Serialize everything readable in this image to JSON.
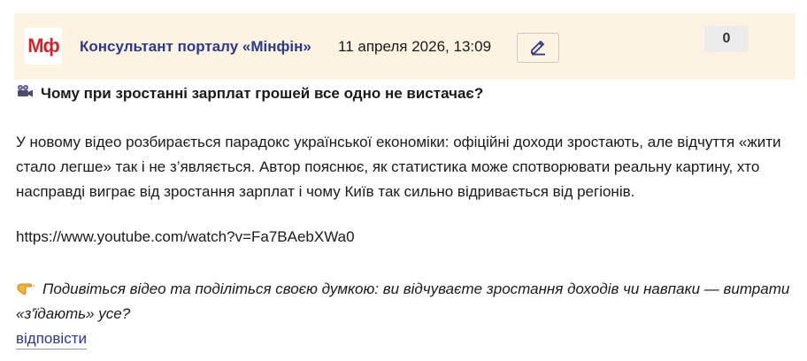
{
  "header": {
    "logo_text": "Мф",
    "author": "Консультант порталу «Мінфін»",
    "date": "11 апреля 2026, 13:09",
    "counter": "0",
    "edit_icon": "pencil-icon",
    "background": "#fcf3e2"
  },
  "post": {
    "title_icon": "camera-icon",
    "title": "Чому при зростанні зарплат грошей все одно не вистачає?",
    "body": "У новому відео розбирається парадокс української економіки: офіційні доходи зростають, але відчуття «жити стало легше» так і не з’являється. Автор пояснює, як статистика може спотворювати реальну картину, хто насправді виграє від зростання зарплат і чому Київ так сильно відривається від регіонів.",
    "link": "https://www.youtube.com/watch?v=Fa7BAebXWa0",
    "cta_icon": "pointing-hand-icon",
    "cta": "Подивіться відео та поділіться своєю думкою: ви відчуваєте зростання доходів чи навпаки — витрати «з'їдають» усе?"
  },
  "actions": {
    "reply_label": "відповісти"
  },
  "colors": {
    "author": "#2b3a8c",
    "logo": "#d7262b"
  }
}
